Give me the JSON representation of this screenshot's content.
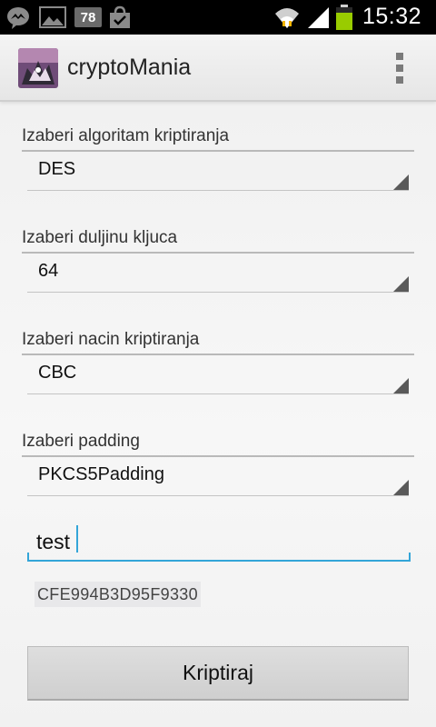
{
  "status_bar": {
    "notification_badge": "78",
    "time": "15:32",
    "icons": [
      "messenger-icon",
      "image-icon",
      "notification-count-badge",
      "shopping-bag-icon",
      "wifi-icon",
      "signal-icon",
      "battery-icon"
    ]
  },
  "action_bar": {
    "app_title": "cryptoMania",
    "overflow_icon": "overflow-menu-icon"
  },
  "form": {
    "algorithm": {
      "label": "Izaberi algoritam kriptiranja",
      "value": "DES"
    },
    "key_length": {
      "label": "Izaberi duljinu kljuca",
      "value": "64"
    },
    "mode": {
      "label": "Izaberi nacin kriptiranja",
      "value": "CBC"
    },
    "padding": {
      "label": "Izaberi padding",
      "value": "PKCS5Padding"
    },
    "input": {
      "value": "test"
    },
    "result": "CFE994B3D95F9330",
    "encrypt_button": "Kriptiraj"
  },
  "colors": {
    "accent": "#33a5d8",
    "status_bar_bg": "#000000",
    "battery": "#99cc00"
  }
}
